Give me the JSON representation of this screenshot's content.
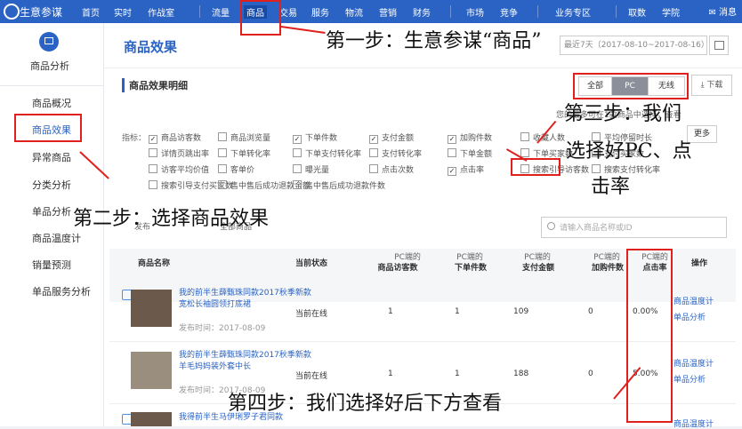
{
  "topbar": {
    "brand": "生意参谋",
    "nav": [
      "首页",
      "实时",
      "作战室",
      "流量",
      "商品",
      "交易",
      "服务",
      "物流",
      "营销",
      "财务",
      "市场",
      "竞争",
      "业务专区",
      "取数",
      "学院"
    ],
    "messages": "消息"
  },
  "sidebar": {
    "section_title": "商品分析",
    "items": [
      "商品概况",
      "商品效果",
      "异常商品",
      "分类分析",
      "单品分析",
      "商品温度计",
      "销量预测",
      "单品服务分析"
    ]
  },
  "main": {
    "page_title": "商品效果",
    "date_range": "最近7天（2017-08-10~2017-08-16）",
    "section_label": "商品效果明细",
    "segments": [
      "全部",
      "PC",
      "无线"
    ],
    "download": "下载",
    "notice": "您的最多可在1款商品中选择，查看",
    "more": "更多",
    "indicator_label": "指标：",
    "indicators": [
      {
        "label": "商品访客数",
        "checked": true
      },
      {
        "label": "商品浏览量",
        "checked": false
      },
      {
        "label": "下单件数",
        "checked": true
      },
      {
        "label": "支付金额",
        "checked": true
      },
      {
        "label": "加购件数",
        "checked": true
      },
      {
        "label": "收藏人数",
        "checked": false
      },
      {
        "label": "平均停留时长",
        "checked": false
      },
      {
        "label": "详情页跳出率",
        "checked": false
      },
      {
        "label": "下单转化率",
        "checked": false
      },
      {
        "label": "下单支付转化率",
        "checked": false
      },
      {
        "label": "支付转化率",
        "checked": false
      },
      {
        "label": "下单金额",
        "checked": false
      },
      {
        "label": "下单买家数",
        "checked": false
      },
      {
        "label": "支付买家数",
        "checked": false
      },
      {
        "label": "访客平均价值",
        "checked": false
      },
      {
        "label": "客单价",
        "checked": false
      },
      {
        "label": "曝光量",
        "checked": false
      },
      {
        "label": "点击次数",
        "checked": false
      },
      {
        "label": "点击率",
        "checked": true
      },
      {
        "label": "搜索引导访客数",
        "checked": false
      },
      {
        "label": "搜索支付转化率",
        "checked": false
      },
      {
        "label": "搜索引导支付买家数",
        "checked": false
      },
      {
        "label": "售中售后成功退款金额",
        "checked": false
      },
      {
        "label": "售中售后成功退款件数",
        "checked": false
      }
    ],
    "search_placeholder": "请输入商品名称或ID",
    "tab_links": [
      "发布",
      "全部商品"
    ],
    "columns": {
      "name": "商品名称",
      "status": "当前状态",
      "c1_top": "PC端的",
      "c1_bottom": "商品访客数",
      "c2_top": "PC端的",
      "c2_bottom": "下单件数",
      "c3_top": "PC端的",
      "c3_bottom": "支付金额",
      "c4_top": "PC端的",
      "c4_bottom": "加购件数",
      "c5_top": "PC端的",
      "c5_bottom": "点击率",
      "ops": "操作"
    },
    "rows": [
      {
        "title": "我的前半生薛甄珠同款2017秋季新款宽松长袖圆领打底裙",
        "date": "发布时间：2017-08-09",
        "status": "当前在线",
        "visitors": "1",
        "orders": "1",
        "pay": "109",
        "cart": "0",
        "ctr": "0.00%",
        "op1": "商品温度计",
        "op2": "单品分析"
      },
      {
        "title": "我的前半生薛甄珠同款2017秋季新款羊毛妈妈装外套中长",
        "date": "发布时间：2017-08-09",
        "status": "当前在线",
        "visitors": "1",
        "orders": "1",
        "pay": "188",
        "cart": "0",
        "ctr": "5.00%",
        "op1": "商品温度计",
        "op2": "单品分析"
      },
      {
        "title": "我得前半生马伊琍罗子君同款",
        "op1": "商品温度计"
      }
    ]
  },
  "annotations": {
    "step1": "第一步：生意参谋“商品”",
    "step2": "第二步：选择商品效果",
    "step3_l1": "第三步：我们",
    "step3_l2": "选择好PC、点",
    "step3_l3": "击率",
    "step4": "第四步：我们选择好后下方查看"
  },
  "colors": {
    "brand_blue": "#2a63c4",
    "annotation_red": "#e0201d"
  }
}
